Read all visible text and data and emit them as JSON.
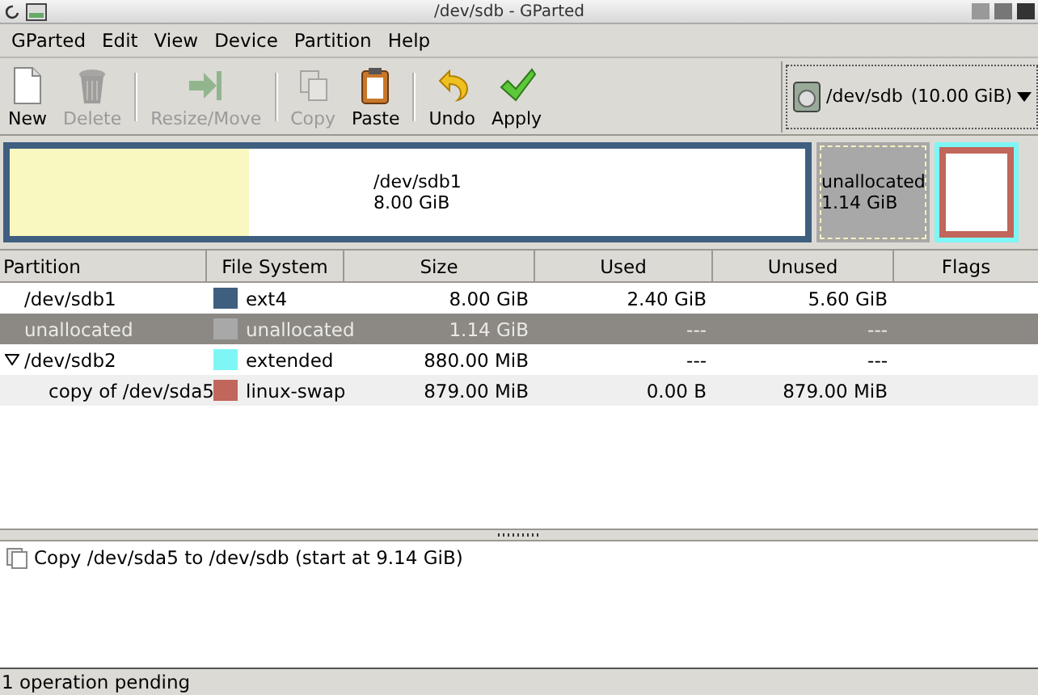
{
  "window": {
    "title": "/dev/sdb - GParted"
  },
  "menu": [
    "GParted",
    "Edit",
    "View",
    "Device",
    "Partition",
    "Help"
  ],
  "toolbar": [
    {
      "kind": "button",
      "label": "New",
      "disabled": false
    },
    {
      "kind": "button",
      "label": "Delete",
      "disabled": true
    },
    {
      "kind": "separator"
    },
    {
      "kind": "button",
      "label": "Resize/Move",
      "disabled": true
    },
    {
      "kind": "separator"
    },
    {
      "kind": "button",
      "label": "Copy",
      "disabled": true
    },
    {
      "kind": "button",
      "label": "Paste",
      "disabled": false
    },
    {
      "kind": "separator"
    },
    {
      "kind": "button",
      "label": "Undo",
      "disabled": false
    },
    {
      "kind": "button",
      "label": "Apply",
      "disabled": false
    }
  ],
  "device_selector": {
    "device": "/dev/sdb",
    "size": "(10.00 GiB)"
  },
  "disk_map": [
    {
      "kind": "partition",
      "color": "#3f5f80",
      "level": 0.3,
      "name": "/dev/sdb1",
      "size": "8.00 GiB"
    },
    {
      "kind": "unallocated",
      "color": "#a8a8a8",
      "name": "unallocated",
      "size": "1.14 GiB"
    },
    {
      "kind": "extended",
      "color": "#7ef6f6",
      "children": [
        {
          "kind": "partition",
          "color": "#c1665a"
        }
      ]
    }
  ],
  "table": {
    "columns": [
      "Partition",
      "File System",
      "Size",
      "Used",
      "Unused",
      "Flags"
    ],
    "rows": [
      {
        "partition": "/dev/sdb1",
        "file_system": "ext4",
        "color": "#3f5f80",
        "size": "8.00 GiB",
        "used": "2.40 GiB",
        "unused": "5.60 GiB",
        "selected": false
      },
      {
        "partition": "unallocated",
        "file_system": "unallocated",
        "color": "#a8a8a8",
        "size": "1.14 GiB",
        "used": "---",
        "unused": "---",
        "selected": true
      },
      {
        "partition": "/dev/sdb2",
        "file_system": "extended",
        "color": "#7ef6f6",
        "size": "880.00 MiB",
        "used": "---",
        "unused": "---",
        "selected": false,
        "expanded": true,
        "children": [
          {
            "partition": "copy of /dev/sda5",
            "file_system": "linux-swap",
            "color": "#c1665a",
            "size": "879.00 MiB",
            "used": "0.00 B",
            "unused": "879.00 MiB",
            "selected": false
          }
        ]
      }
    ]
  },
  "operations": [
    "Copy /dev/sda5 to /dev/sdb (start at 9.14 GiB)"
  ],
  "status_bar": "1 operation pending"
}
